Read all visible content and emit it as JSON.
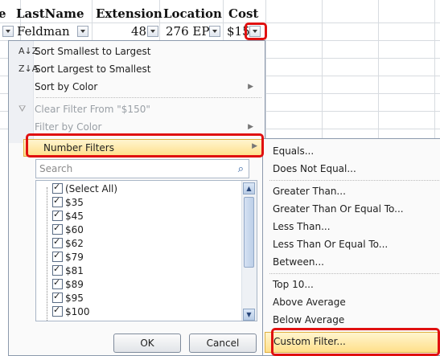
{
  "columns": {
    "h1": "e",
    "h2": "LastName",
    "h3": "Extension",
    "h4": "Location",
    "h5": "Cost"
  },
  "row1": {
    "c1": "Feldman",
    "c2": "48",
    "c3": "276 EP",
    "c4": "$15"
  },
  "menu": {
    "sort_asc_icon": "A↓Z",
    "sort_asc": "Sort Smallest to Largest",
    "sort_desc_icon": "Z↓A",
    "sort_desc": "Sort Largest to Smallest",
    "sort_color": "Sort by Color",
    "clear_filter": "Clear Filter From \"$150\"",
    "filter_color": "Filter by Color",
    "number_filters": "Number Filters",
    "search_placeholder": "Search",
    "items": [
      "(Select All)",
      "$35",
      "$45",
      "$60",
      "$62",
      "$79",
      "$81",
      "$89",
      "$95",
      "$100"
    ],
    "ok": "OK",
    "cancel": "Cancel"
  },
  "submenu": {
    "equals": "Equals...",
    "not_equal": "Does Not Equal...",
    "greater": "Greater Than...",
    "greater_eq": "Greater Than Or Equal To...",
    "less": "Less Than...",
    "less_eq": "Less Than Or Equal To...",
    "between": "Between...",
    "top10": "Top 10...",
    "above_avg": "Above Average",
    "below_avg": "Below Average",
    "custom": "Custom Filter..."
  },
  "colors": {
    "highlight": "#e01010",
    "hover": "#ffdf8a"
  }
}
